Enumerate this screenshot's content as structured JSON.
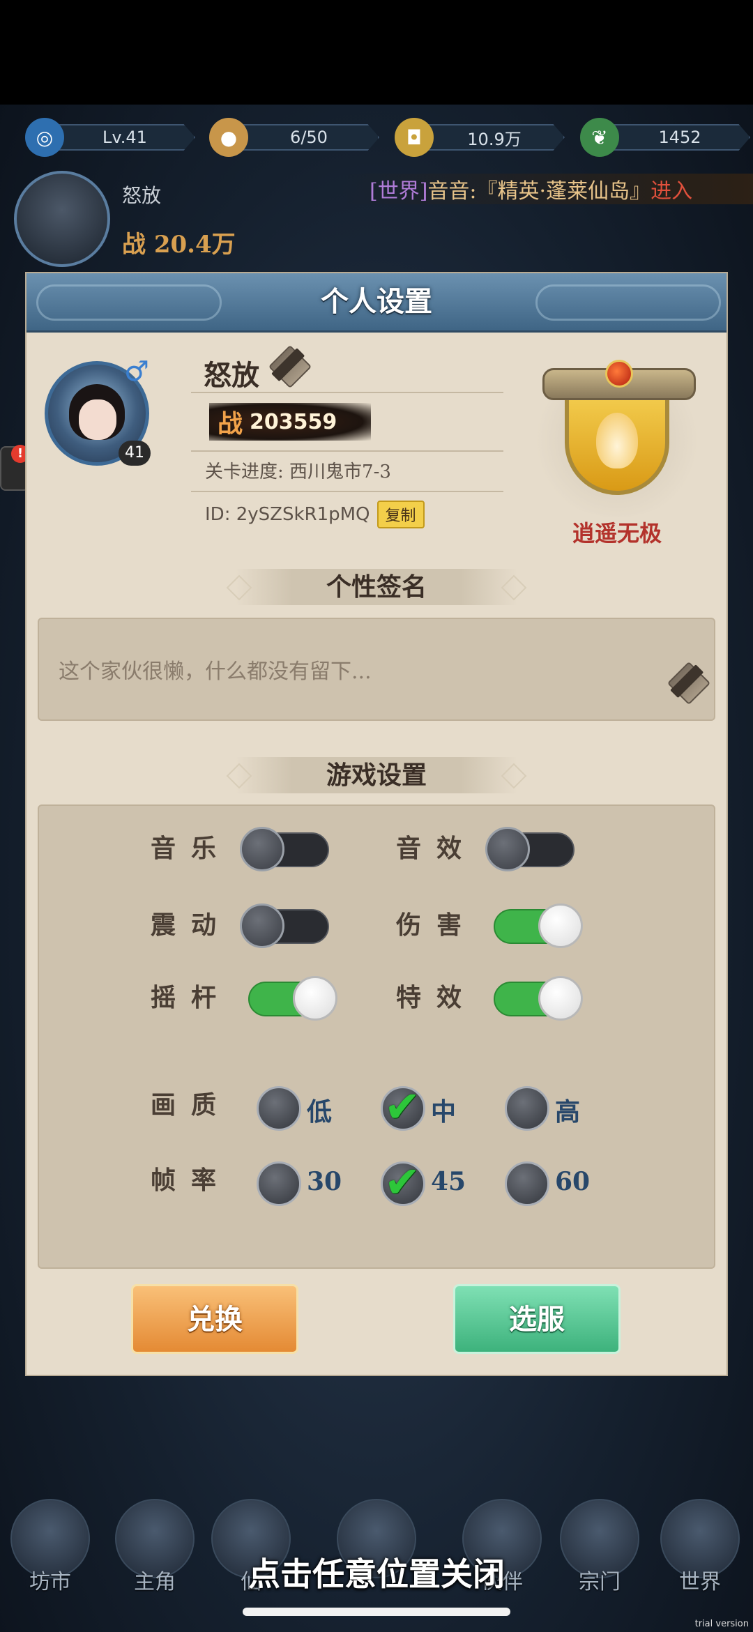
{
  "topbar": {
    "level": "Lv.41",
    "stamina": "6/50",
    "coins": "10.9万",
    "jade": "1452"
  },
  "player_header": {
    "name": "怒放",
    "power": "战 20.4万",
    "chat_channel": "[世界]",
    "chat_text": "音音:『精英·蓬莱仙岛』",
    "chat_action": "进入"
  },
  "panel": {
    "title": "个人设置",
    "avatar_level": "41",
    "name": "怒放",
    "power_icon": "战",
    "power_value": "203559",
    "stage": "关卡进度: 西川鬼市7-3",
    "id": "ID: 2ySZSkR1pMQ",
    "copy": "复制",
    "guild": "逍遥无极",
    "signature_title": "个性签名",
    "signature": "这个家伙很懒，什么都没有留下...",
    "game_settings_title": "游戏设置",
    "toggles": {
      "music": {
        "label": "音乐",
        "on": false
      },
      "sfx": {
        "label": "音效",
        "on": false
      },
      "vibration": {
        "label": "震动",
        "on": false
      },
      "damage": {
        "label": "伤害",
        "on": true
      },
      "joystick": {
        "label": "摇杆",
        "on": true
      },
      "effects": {
        "label": "特效",
        "on": true
      }
    },
    "quality": {
      "label": "画质",
      "options": [
        "低",
        "中",
        "高"
      ],
      "selected": "中"
    },
    "framerate": {
      "label": "帧率",
      "options": [
        "30",
        "45",
        "60"
      ],
      "selected": "45"
    },
    "redeem": "兑换",
    "server": "选服"
  },
  "bottom_nav": [
    "坊市",
    "主角",
    "仙",
    "",
    "伙伴",
    "宗门",
    "世界"
  ],
  "close_hint": "点击任意位置关闭",
  "watermark": "trial version",
  "colors": {
    "header": "#4a7092",
    "toggle_on": "#3fb44a",
    "guild": "#b3322b",
    "redeem": "#e48a34",
    "server": "#3db27c"
  }
}
